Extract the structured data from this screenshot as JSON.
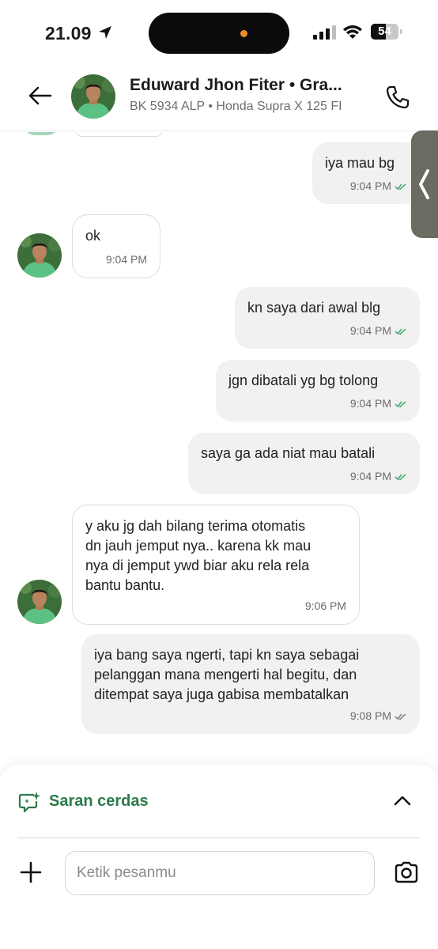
{
  "status_bar": {
    "time": "21.09",
    "battery": "54",
    "battery_level": 0.54
  },
  "header": {
    "name": "Eduward Jhon Fiter • Gra...",
    "subtitle": "BK 5934 ALP • Honda Supra X 125 FI"
  },
  "messages": [
    {
      "direction": "out",
      "text": "iya mau bg",
      "time": "9:04 PM",
      "read": true
    },
    {
      "direction": "in",
      "text": "ok",
      "time": "9:04 PM"
    },
    {
      "direction": "out",
      "text": "kn saya dari awal blg",
      "time": "9:04 PM",
      "read": true
    },
    {
      "direction": "out",
      "text": "jgn dibatali yg bg tolong",
      "time": "9:04 PM",
      "read": true
    },
    {
      "direction": "out",
      "text": "saya ga ada niat mau batali",
      "time": "9:04 PM",
      "read": true
    },
    {
      "direction": "in",
      "text": "y aku jg dah bilang terima otomatis\ndn jauh jemput nya.. karena kk mau\nnya di jemput ywd biar aku rela rela\nbantu bantu.",
      "time": "9:06 PM"
    },
    {
      "direction": "out",
      "text": "iya bang saya ngerti, tapi kn saya sebagai\npelanggan mana mengerti hal begitu, dan\nditempat saya juga gabisa membatalkan",
      "time": "9:08 PM",
      "read": false
    }
  ],
  "composer": {
    "smart_suggestions_label": "Saran cerdas",
    "input_placeholder": "Ketik pesanmu",
    "input_value": ""
  },
  "colors": {
    "brand_green": "#2b7a4b",
    "read_tick": "#3aa864",
    "unread_tick": "#7a7a7a"
  },
  "icons": {
    "back": "arrow-left-icon",
    "call": "phone-icon",
    "suggestions": "sparkle-chat-icon",
    "toggle": "chevron-up-icon",
    "add": "plus-icon",
    "camera": "camera-icon"
  }
}
